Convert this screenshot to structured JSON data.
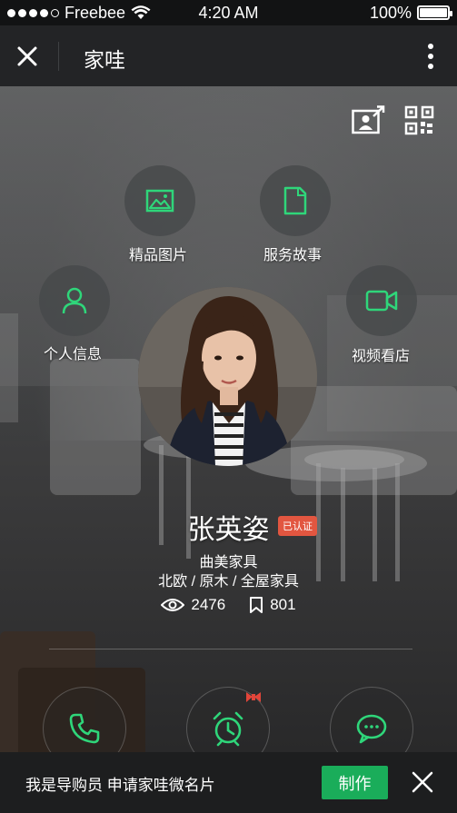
{
  "status_bar": {
    "carrier": "Freebee",
    "time": "4:20 AM",
    "battery": "100%"
  },
  "nav": {
    "title": "家哇",
    "icons": {
      "close": "close-icon",
      "more": "more-vertical-icon"
    }
  },
  "top_icons": [
    "share-profile-icon",
    "qr-code-icon"
  ],
  "menu": {
    "gallery": {
      "label": "精品图片",
      "icon": "image-icon"
    },
    "story": {
      "label": "服务故事",
      "icon": "document-icon"
    },
    "personal": {
      "label": "个人信息",
      "icon": "person-icon"
    },
    "video": {
      "label": "视频看店",
      "icon": "video-camera-icon"
    }
  },
  "profile": {
    "name": "张英姿",
    "verified_badge": "已认证",
    "company": "曲美家具",
    "tags": "北欧 / 原木 / 全屋家具",
    "views": "2476",
    "bookmarks": "801"
  },
  "actions": [
    "phone-icon",
    "alarm-clock-icon",
    "chat-bubble-icon"
  ],
  "bottom_bar": {
    "prompt": "我是导购员  申请家哇微名片",
    "button": "制作"
  },
  "colors": {
    "accent_green": "#1aad5a",
    "icon_green": "#2fd67a",
    "badge_red": "#e25640"
  }
}
